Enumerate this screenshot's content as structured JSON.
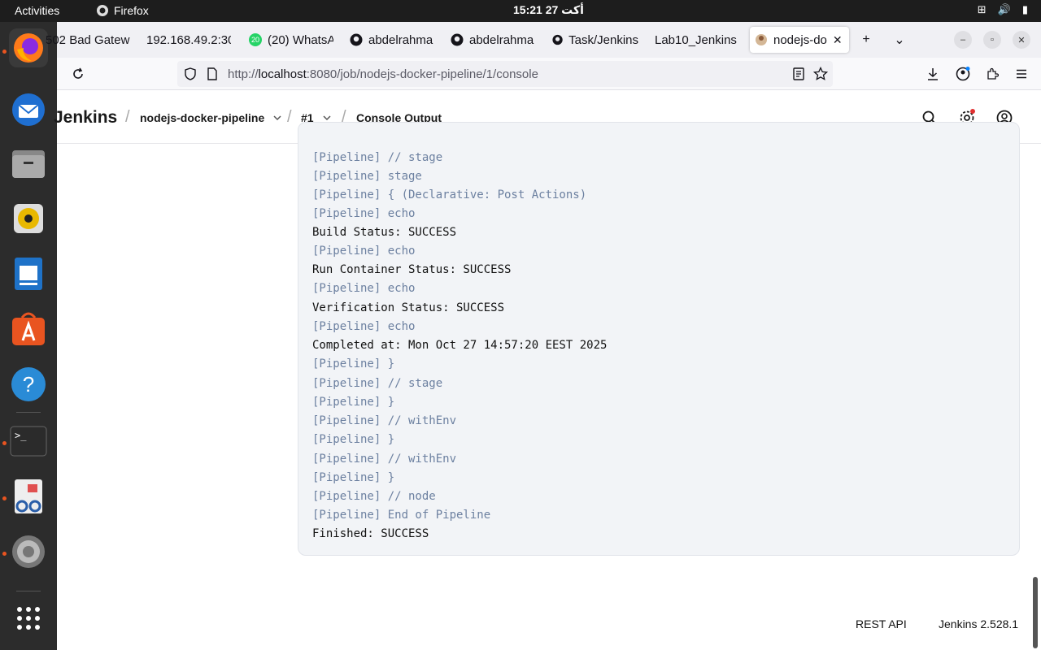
{
  "topbar": {
    "activities": "Activities",
    "app": "Firefox",
    "clock": "15:21  27 أكت"
  },
  "tabs": [
    {
      "title": "502 Bad Gatewa"
    },
    {
      "title": "192.168.49.2:30"
    },
    {
      "title": "(20) WhatsA",
      "badge": "20"
    },
    {
      "title": "abdelrahma"
    },
    {
      "title": "abdelrahma"
    },
    {
      "title": "Task/Jenkins"
    },
    {
      "title": "Lab10_Jenkins"
    },
    {
      "title": "nodejs-do"
    }
  ],
  "url": {
    "prefix": "http://",
    "host": "localhost",
    "rest": ":8080/job/nodejs-docker-pipeline/1/console"
  },
  "jenkins": {
    "brand": "Jenkins",
    "crumb_job": "nodejs-docker-pipeline",
    "crumb_build": "#1",
    "crumb_page": "Console Output"
  },
  "console": {
    "lines": [
      "[Pipeline] // stage",
      "[Pipeline] stage",
      "[Pipeline] { (Declarative: Post Actions)",
      "[Pipeline] echo",
      "Build Status: SUCCESS",
      "[Pipeline] echo",
      "Run Container Status: SUCCESS",
      "[Pipeline] echo",
      "Verification Status: SUCCESS",
      "[Pipeline] echo",
      "Completed at: Mon Oct 27 14:57:20 EEST 2025",
      "[Pipeline] }",
      "[Pipeline] // stage",
      "[Pipeline] }",
      "[Pipeline] // withEnv",
      "[Pipeline] }",
      "[Pipeline] // withEnv",
      "[Pipeline] }",
      "[Pipeline] // node",
      "[Pipeline] End of Pipeline",
      "Finished: SUCCESS"
    ]
  },
  "footer": {
    "rest_api": "REST API",
    "version": "Jenkins 2.528.1"
  }
}
